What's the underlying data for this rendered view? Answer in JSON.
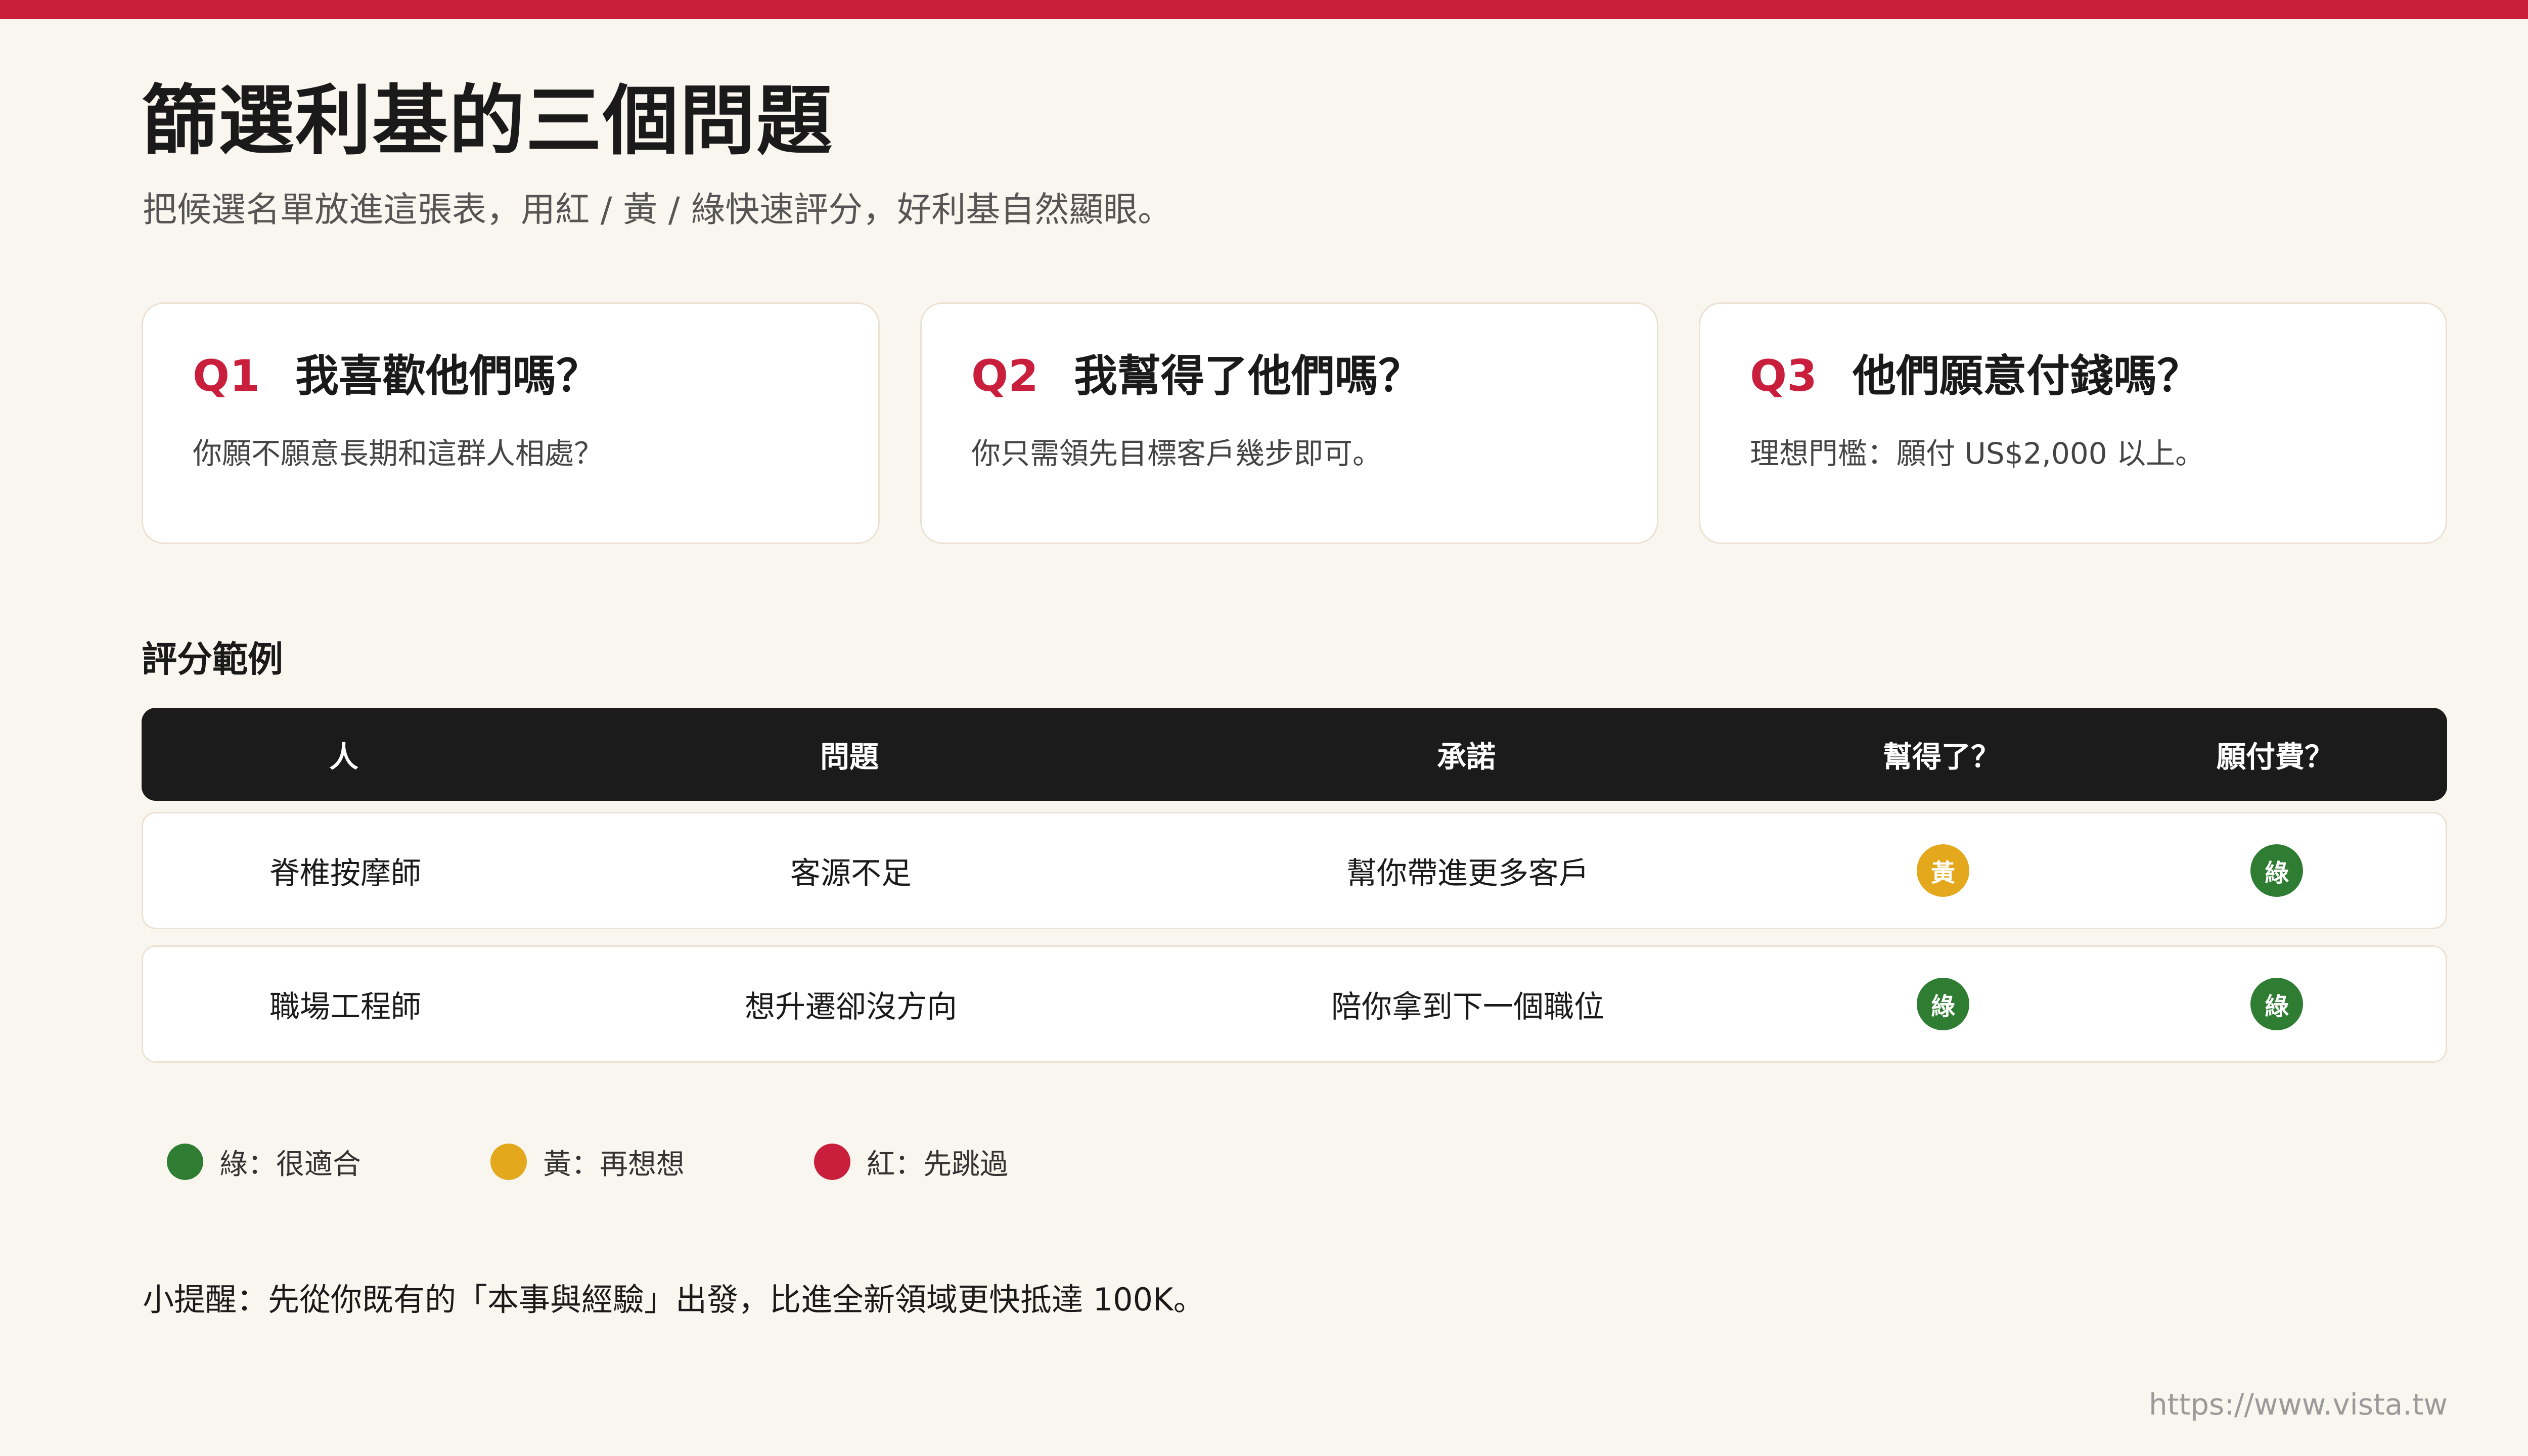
{
  "title": "篩選利基的三個問題",
  "subtitle": "把候選名單放進這張表，用紅 / 黃 / 綠快速評分，好利基自然顯眼。",
  "cards": [
    {
      "q": "Q1",
      "title": "我喜歡他們嗎？",
      "desc": "你願不願意長期和這群人相處？"
    },
    {
      "q": "Q2",
      "title": "我幫得了他們嗎？",
      "desc": "你只需領先目標客戶幾步即可。"
    },
    {
      "q": "Q3",
      "title": "他們願意付錢嗎？",
      "desc": "理想門檻：願付 US$2,000 以上。"
    }
  ],
  "section_label": "評分範例",
  "table": {
    "headers": [
      "人",
      "問題",
      "承諾",
      "幫得了？",
      "願付費？"
    ],
    "rows": [
      {
        "person": "脊椎按摩師",
        "problem": "客源不足",
        "promise": "幫你帶進更多客戶",
        "can_help": {
          "label": "黃",
          "color": "#e3a81c"
        },
        "will_pay": {
          "label": "綠",
          "color": "#2e7d32"
        }
      },
      {
        "person": "職場工程師",
        "problem": "想升遷卻沒方向",
        "promise": "陪你拿到下一個職位",
        "can_help": {
          "label": "綠",
          "color": "#2e7d32"
        },
        "will_pay": {
          "label": "綠",
          "color": "#2e7d32"
        }
      }
    ]
  },
  "legend": [
    {
      "label": "綠：很適合",
      "color": "#2e7d32"
    },
    {
      "label": "黃：再想想",
      "color": "#e3a81c"
    },
    {
      "label": "紅：先跳過",
      "color": "#c91f3d"
    }
  ],
  "tip": "小提醒：先從你既有的「本事與經驗」出發，比進全新領域更快抵達 100K。",
  "footer_url": "https://www.vista.tw",
  "colors": {
    "accent": "#c91f3d",
    "green": "#2e7d32",
    "yellow": "#e3a81c",
    "red": "#c91f3d"
  }
}
